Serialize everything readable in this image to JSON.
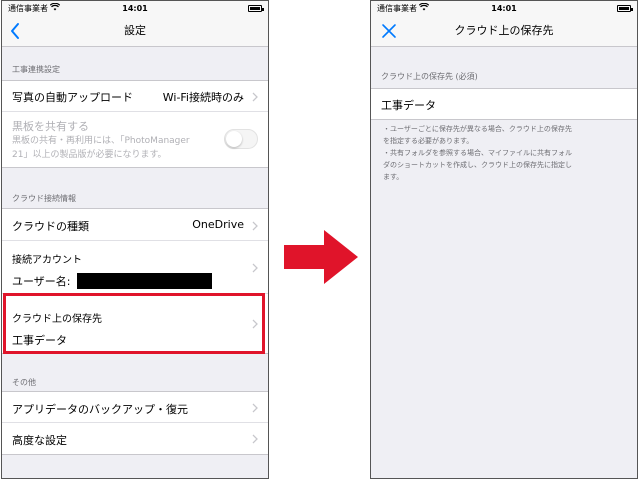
{
  "status_bar": {
    "carrier": "通信事業者",
    "time": "14:01"
  },
  "left_screen": {
    "nav": {
      "title": "設定",
      "back_icon": "chevron-left-icon"
    },
    "section1": {
      "header": "工事連携設定",
      "auto_upload": {
        "label": "写真の自動アップロード",
        "value": "Wi-Fi接続時のみ"
      },
      "share": {
        "label": "黒板を共有する",
        "desc_line1": "黒板の共有・再利用には、「PhotoManager",
        "desc_line2": "21」以上の製品版が必要になります。",
        "enabled": false
      }
    },
    "section2": {
      "header": "クラウド接続情報",
      "cloud_type": {
        "label": "クラウドの種類",
        "value": "OneDrive"
      },
      "account": {
        "label": "接続アカウント",
        "user_label": "ユーザー名:"
      },
      "save_dest": {
        "label": "クラウド上の保存先",
        "value": "工事データ"
      }
    },
    "section3": {
      "header": "その他",
      "backup": {
        "label": "アプリデータのバックアップ・復元"
      },
      "advanced": {
        "label": "高度な設定"
      }
    }
  },
  "right_screen": {
    "nav": {
      "title": "クラウド上の保存先",
      "close_icon": "close-icon"
    },
    "section_header": "クラウド上の保存先 (必須)",
    "value": "工事データ",
    "notes": {
      "line1": "・ユーザーごとに保存先が異なる場合、クラウド上の保存先",
      "line2": "を指定する必要があります。",
      "line3": "・共有フォルダを参照する場合、マイファイルに共有フォル",
      "line4": "ダのショートカットを作成し、クラウド上の保存先に指定し",
      "line5": "ます。"
    }
  },
  "colors": {
    "accent": "#007aff",
    "highlight": "#e0142a",
    "arrow": "#e0142a",
    "background": "#efeff4"
  }
}
